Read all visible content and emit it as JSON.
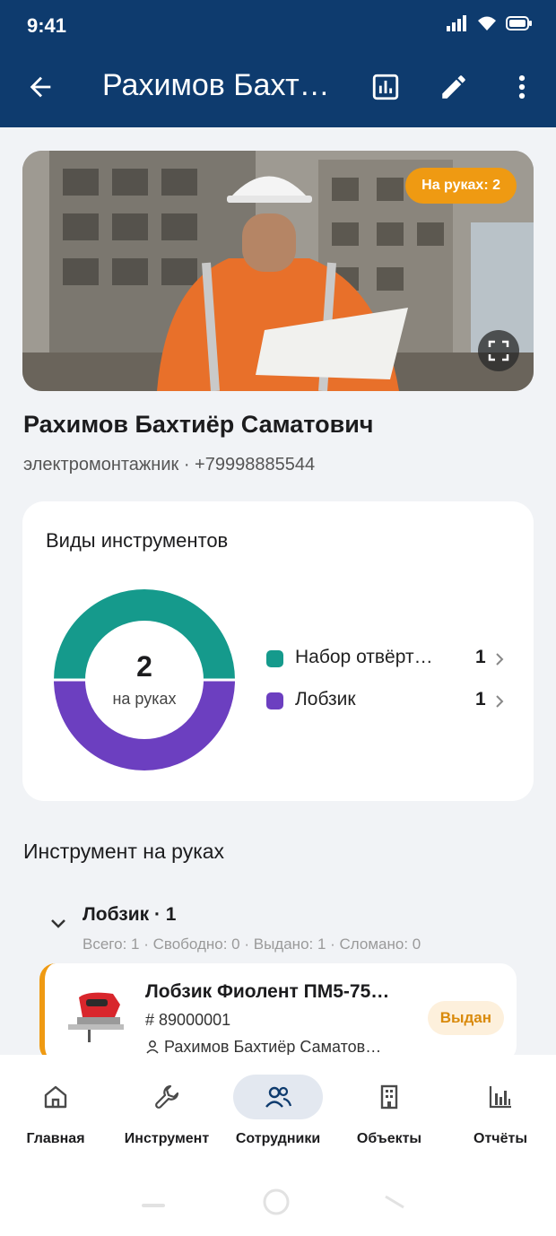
{
  "status_bar": {
    "time": "9:41"
  },
  "appbar": {
    "title": "Рахимов Бахт…"
  },
  "icons": {
    "back": "arrow-left-icon",
    "stats": "bar-chart-icon",
    "edit": "pencil-icon",
    "more": "more-vertical-icon",
    "expand": "expand-icon",
    "chevron": "chevron-right-icon",
    "collapse": "chevron-down-icon",
    "hash": "hash-icon",
    "user": "user-icon"
  },
  "hero": {
    "badge": "На руках: 2"
  },
  "employee": {
    "name": "Рахимов Бахтиёр Саматович",
    "subtitle": "электромонтажник · +79998885544"
  },
  "tool_types": {
    "title": "Виды инструментов",
    "center_value": "2",
    "center_label": "на руках",
    "items": [
      {
        "label": "Набор отвёрт…",
        "count": "1",
        "color": "#159a8c"
      },
      {
        "label": "Лобзик",
        "count": "1",
        "color": "#6c3fc0"
      }
    ]
  },
  "chart_data": {
    "type": "pie",
    "categories": [
      "Набор отвёрт…",
      "Лобзик"
    ],
    "values": [
      1,
      1
    ],
    "colors": [
      "#159a8c",
      "#6c3fc0"
    ],
    "title": "Виды инструментов",
    "center_value": "2",
    "center_label": "на руках"
  },
  "on_hand": {
    "title": "Инструмент на руках",
    "group": {
      "title": "Лобзик · 1",
      "stats": "Всего: 1 · Свободно: 0 · Выдано: 1 · Сломано: 0"
    },
    "item": {
      "title": "Лобзик Фиолент ПМ5-75…",
      "number": "89000001",
      "user": "Рахимов Бахтиёр Саматов…",
      "status": "Выдан"
    }
  },
  "colors": {
    "accent": "#0e3b6e",
    "orange": "#ef9a12",
    "teal": "#159a8c",
    "purple": "#6c3fc0"
  },
  "bottom_nav": [
    {
      "label": "Главная",
      "icon": "home-icon"
    },
    {
      "label": "Инструмент",
      "icon": "wrench-icon"
    },
    {
      "label": "Сотрудники",
      "icon": "users-icon",
      "active": true
    },
    {
      "label": "Объекты",
      "icon": "building-icon"
    },
    {
      "label": "Отчёты",
      "icon": "bar-chart-icon"
    }
  ]
}
